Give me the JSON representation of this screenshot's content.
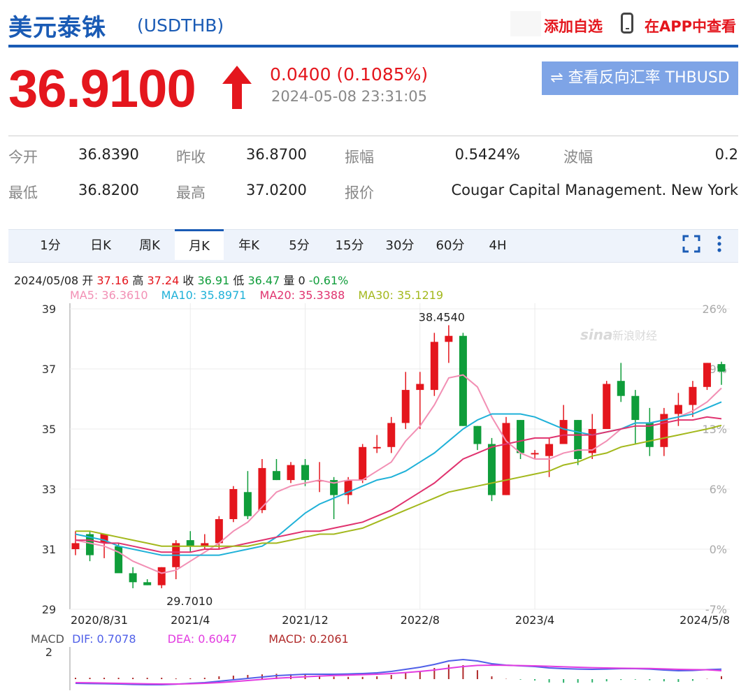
{
  "header": {
    "name": "美元泰铢",
    "symbol": "(USDTHB)",
    "fav_label": "添加自选",
    "app_label": "在APP中查看"
  },
  "quote": {
    "price": "36.9100",
    "change": "0.0400 (0.1085%)",
    "timestamp": "2024-05-08 23:31:05",
    "reverse_label": "⇌ 查看反向汇率 THBUSD",
    "up_color": "#e4161d"
  },
  "stats": [
    {
      "label": "今开",
      "value": "36.8390"
    },
    {
      "label": "昨收",
      "value": "36.8700"
    },
    {
      "label": "振幅",
      "value": "0.5424%"
    },
    {
      "label": "波幅",
      "value": "0.2"
    },
    {
      "label": "最低",
      "value": "36.8200"
    },
    {
      "label": "最高",
      "value": "37.0200"
    },
    {
      "label": "报价",
      "value": "Cougar Capital Management. New York"
    }
  ],
  "tabs": [
    "1分",
    "日K",
    "周K",
    "月K",
    "年K",
    "5分",
    "15分",
    "30分",
    "60分",
    "4H"
  ],
  "active_tab": "月K",
  "info_line": {
    "date": "2024/05/08",
    "open_label": "开",
    "open": "37.16",
    "high_label": "高",
    "high": "37.24",
    "close_label": "收",
    "close": "36.91",
    "low_label": "低",
    "low": "36.47",
    "vol_label": "量",
    "vol": "0",
    "pct": "-0.61%"
  },
  "ma_legend": [
    {
      "text": "MA5: 36.3610",
      "color": "#f28fb4"
    },
    {
      "text": "MA10: 35.8971",
      "color": "#1fb1d8"
    },
    {
      "text": "MA20: 35.3388",
      "color": "#e0336f"
    },
    {
      "text": "MA30: 35.1219",
      "color": "#a3b81c"
    }
  ],
  "macd_legend": {
    "label": "MACD",
    "dif": "DIF: 0.7078",
    "dea": "DEA: 0.6047",
    "macd": "MACD: 0.2061"
  },
  "chart_data": {
    "type": "candlestick",
    "y_ticks": [
      "39",
      "37",
      "35",
      "33",
      "31",
      "29"
    ],
    "y_pct_ticks": [
      "26%",
      "19%",
      "13%",
      "6%",
      "0%",
      "-7%"
    ],
    "ylim": [
      29,
      39
    ],
    "x_labels": [
      "2020/8/31",
      "2021/4",
      "2021/12",
      "2022/8",
      "2023/4",
      "2024/5/8"
    ],
    "x_label_index": [
      0,
      8,
      16,
      24,
      32,
      44
    ],
    "annotations": [
      {
        "text": "38.4540",
        "index": 26
      },
      {
        "text": "29.7010",
        "index": 6
      }
    ],
    "up_color": "#e4161d",
    "down_color": "#0f9d3a",
    "candles": [
      {
        "o": 31.0,
        "h": 31.6,
        "l": 30.8,
        "c": 31.2
      },
      {
        "o": 31.5,
        "h": 31.6,
        "l": 30.6,
        "c": 30.8
      },
      {
        "o": 31.2,
        "h": 31.5,
        "l": 30.7,
        "c": 31.5
      },
      {
        "o": 31.1,
        "h": 31.2,
        "l": 30.3,
        "c": 30.2
      },
      {
        "o": 30.2,
        "h": 30.4,
        "l": 29.7,
        "c": 29.9
      },
      {
        "o": 29.9,
        "h": 30.0,
        "l": 29.8,
        "c": 29.8
      },
      {
        "o": 29.8,
        "h": 30.4,
        "l": 29.7,
        "c": 30.4
      },
      {
        "o": 30.4,
        "h": 31.3,
        "l": 30.0,
        "c": 31.2
      },
      {
        "o": 31.3,
        "h": 31.6,
        "l": 30.9,
        "c": 31.1
      },
      {
        "o": 31.1,
        "h": 31.5,
        "l": 31.0,
        "c": 31.2
      },
      {
        "o": 31.2,
        "h": 32.1,
        "l": 31.0,
        "c": 32.0
      },
      {
        "o": 32.0,
        "h": 33.1,
        "l": 31.9,
        "c": 33.0
      },
      {
        "o": 32.9,
        "h": 33.6,
        "l": 32.0,
        "c": 32.1
      },
      {
        "o": 32.3,
        "h": 34.0,
        "l": 32.2,
        "c": 33.7
      },
      {
        "o": 33.6,
        "h": 34.0,
        "l": 33.3,
        "c": 33.3
      },
      {
        "o": 33.3,
        "h": 33.9,
        "l": 33.2,
        "c": 33.8
      },
      {
        "o": 33.8,
        "h": 34.0,
        "l": 33.1,
        "c": 33.3
      },
      {
        "o": 33.3,
        "h": 33.9,
        "l": 32.9,
        "c": 33.3
      },
      {
        "o": 33.3,
        "h": 33.4,
        "l": 32.0,
        "c": 32.8
      },
      {
        "o": 32.8,
        "h": 33.4,
        "l": 32.5,
        "c": 33.3
      },
      {
        "o": 33.3,
        "h": 34.5,
        "l": 33.2,
        "c": 34.4
      },
      {
        "o": 34.4,
        "h": 34.8,
        "l": 34.2,
        "c": 34.4
      },
      {
        "o": 34.4,
        "h": 35.4,
        "l": 34.2,
        "c": 35.2
      },
      {
        "o": 35.2,
        "h": 36.9,
        "l": 35.0,
        "c": 36.3
      },
      {
        "o": 36.3,
        "h": 36.9,
        "l": 35.0,
        "c": 36.5
      },
      {
        "o": 36.3,
        "h": 38.2,
        "l": 36.1,
        "c": 37.9
      },
      {
        "o": 37.9,
        "h": 38.454,
        "l": 37.2,
        "c": 38.1
      },
      {
        "o": 38.1,
        "h": 38.2,
        "l": 35.1,
        "c": 35.1
      },
      {
        "o": 35.1,
        "h": 35.1,
        "l": 34.3,
        "c": 34.5
      },
      {
        "o": 34.5,
        "h": 34.7,
        "l": 32.6,
        "c": 32.8
      },
      {
        "o": 32.8,
        "h": 35.4,
        "l": 32.8,
        "c": 35.2
      },
      {
        "o": 35.3,
        "h": 35.3,
        "l": 34.0,
        "c": 34.2
      },
      {
        "o": 34.2,
        "h": 34.3,
        "l": 34.0,
        "c": 34.2
      },
      {
        "o": 34.1,
        "h": 34.7,
        "l": 33.4,
        "c": 34.5
      },
      {
        "o": 34.5,
        "h": 35.8,
        "l": 34.5,
        "c": 35.3
      },
      {
        "o": 35.3,
        "h": 35.3,
        "l": 33.8,
        "c": 34.0
      },
      {
        "o": 34.2,
        "h": 35.5,
        "l": 34.0,
        "c": 35.0
      },
      {
        "o": 35.0,
        "h": 36.6,
        "l": 35.0,
        "c": 36.5
      },
      {
        "o": 36.6,
        "h": 37.2,
        "l": 35.9,
        "c": 36.1
      },
      {
        "o": 36.1,
        "h": 36.3,
        "l": 34.5,
        "c": 35.3
      },
      {
        "o": 35.2,
        "h": 35.7,
        "l": 34.1,
        "c": 34.4
      },
      {
        "o": 34.4,
        "h": 35.7,
        "l": 34.1,
        "c": 35.5
      },
      {
        "o": 35.5,
        "h": 36.2,
        "l": 35.1,
        "c": 35.8
      },
      {
        "o": 35.8,
        "h": 36.6,
        "l": 35.4,
        "c": 36.4
      },
      {
        "o": 36.4,
        "h": 37.2,
        "l": 36.3,
        "c": 37.2
      },
      {
        "o": 37.16,
        "h": 37.24,
        "l": 36.47,
        "c": 36.91
      }
    ],
    "ma5": [
      31.3,
      31.2,
      31.1,
      30.9,
      30.6,
      30.4,
      30.2,
      30.3,
      30.6,
      30.9,
      31.2,
      31.6,
      31.9,
      32.4,
      32.9,
      33.1,
      33.2,
      33.3,
      33.2,
      33.3,
      33.3,
      33.6,
      33.9,
      34.6,
      35.1,
      35.8,
      36.7,
      36.8,
      36.4,
      35.4,
      34.6,
      34.2,
      34.0,
      34.0,
      34.2,
      34.3,
      34.3,
      34.6,
      35.0,
      35.2,
      35.2,
      35.3,
      35.4,
      35.6,
      35.9,
      36.36
    ],
    "ma10": [
      31.5,
      31.4,
      31.3,
      31.1,
      31.0,
      30.9,
      30.8,
      30.8,
      30.8,
      30.8,
      30.8,
      30.9,
      31.0,
      31.1,
      31.4,
      31.8,
      32.2,
      32.5,
      32.7,
      32.9,
      33.1,
      33.3,
      33.4,
      33.6,
      33.9,
      34.2,
      34.6,
      35.0,
      35.3,
      35.5,
      35.5,
      35.5,
      35.4,
      35.2,
      35.0,
      34.9,
      34.8,
      34.9,
      35.0,
      35.2,
      35.2,
      35.3,
      35.4,
      35.5,
      35.7,
      35.9
    ],
    "ma20": [
      31.3,
      31.3,
      31.2,
      31.2,
      31.1,
      31.0,
      30.9,
      30.9,
      30.9,
      31.0,
      31.0,
      31.1,
      31.2,
      31.3,
      31.4,
      31.5,
      31.6,
      31.6,
      31.7,
      31.8,
      31.9,
      32.1,
      32.3,
      32.6,
      32.9,
      33.2,
      33.6,
      34.0,
      34.2,
      34.4,
      34.5,
      34.6,
      34.7,
      34.7,
      34.8,
      34.8,
      34.8,
      34.9,
      35.0,
      35.1,
      35.1,
      35.2,
      35.3,
      35.3,
      35.4,
      35.34
    ],
    "ma30": [
      31.6,
      31.6,
      31.5,
      31.4,
      31.3,
      31.2,
      31.1,
      31.1,
      31.1,
      31.1,
      31.1,
      31.1,
      31.1,
      31.2,
      31.2,
      31.3,
      31.4,
      31.5,
      31.5,
      31.6,
      31.7,
      31.9,
      32.1,
      32.3,
      32.5,
      32.7,
      32.9,
      33.0,
      33.1,
      33.2,
      33.3,
      33.4,
      33.5,
      33.6,
      33.8,
      33.9,
      34.1,
      34.2,
      34.4,
      34.5,
      34.6,
      34.7,
      34.8,
      34.9,
      35.0,
      35.12
    ],
    "macd": {
      "y_tick": "2",
      "dif": [
        -0.3,
        -0.32,
        -0.33,
        -0.35,
        -0.38,
        -0.4,
        -0.4,
        -0.36,
        -0.3,
        -0.25,
        -0.15,
        -0.05,
        0.05,
        0.15,
        0.25,
        0.3,
        0.35,
        0.35,
        0.35,
        0.37,
        0.4,
        0.45,
        0.55,
        0.7,
        0.85,
        1.05,
        1.3,
        1.4,
        1.3,
        1.1,
        1.0,
        0.95,
        0.9,
        0.8,
        0.75,
        0.72,
        0.7,
        0.72,
        0.75,
        0.75,
        0.72,
        0.65,
        0.6,
        0.62,
        0.68,
        0.71
      ],
      "dea": [
        -0.25,
        -0.26,
        -0.28,
        -0.3,
        -0.32,
        -0.34,
        -0.35,
        -0.35,
        -0.33,
        -0.3,
        -0.25,
        -0.18,
        -0.1,
        -0.02,
        0.06,
        0.12,
        0.17,
        0.22,
        0.26,
        0.29,
        0.32,
        0.35,
        0.4,
        0.47,
        0.55,
        0.65,
        0.78,
        0.9,
        0.98,
        1.0,
        0.99,
        0.97,
        0.95,
        0.92,
        0.88,
        0.85,
        0.82,
        0.8,
        0.78,
        0.77,
        0.76,
        0.73,
        0.7,
        0.68,
        0.67,
        0.6
      ],
      "hist": [
        0.1,
        0.1,
        0.1,
        0.1,
        0.1,
        0.1,
        0.1,
        0.05,
        0.06,
        0.1,
        0.2,
        0.25,
        0.3,
        0.34,
        0.38,
        0.36,
        0.36,
        0.26,
        0.18,
        0.16,
        0.16,
        0.2,
        0.3,
        0.46,
        0.6,
        0.8,
        1.04,
        1.0,
        0.64,
        0.2,
        0.02,
        -0.04,
        -0.1,
        -0.24,
        -0.26,
        -0.26,
        -0.24,
        -0.16,
        -0.06,
        -0.04,
        -0.08,
        -0.16,
        -0.2,
        -0.12,
        0.02,
        0.21
      ]
    }
  }
}
